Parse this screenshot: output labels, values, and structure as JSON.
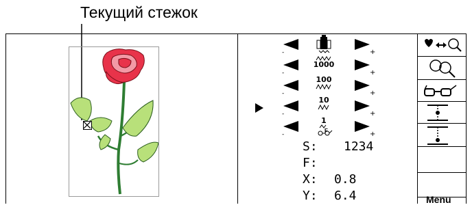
{
  "callout": {
    "label": "Текущий стежок"
  },
  "step_rows": [
    {
      "step": "",
      "icon": "color-change-icon"
    },
    {
      "step": "1000",
      "icon": "stitch-step-icon"
    },
    {
      "step": "100",
      "icon": "stitch-step-icon"
    },
    {
      "step": "10",
      "icon": "stitch-step-icon"
    },
    {
      "step": "1",
      "icon": "stitch-step-icon"
    },
    {
      "step": "F",
      "icon": "glasses-frame-icon"
    }
  ],
  "info": {
    "s_label": "S:",
    "s_value": "1234",
    "f_label": "F:",
    "f_value": "",
    "x_label": "X:",
    "x_value": "0.8",
    "y_label": "Y:",
    "y_value": "6.4"
  },
  "right_panel": {
    "buttons": [
      "zoom-toggle-icon",
      "zoom-out-icon",
      "glasses-view-icon",
      "center-move-icon",
      "down-move-icon",
      "blank",
      "blank"
    ],
    "menu_label": "Menu"
  },
  "colors": {
    "rose": "#e8334a",
    "rose_light": "#f39aa6",
    "leaf": "#b8e07a",
    "stem": "#2e7d32"
  }
}
